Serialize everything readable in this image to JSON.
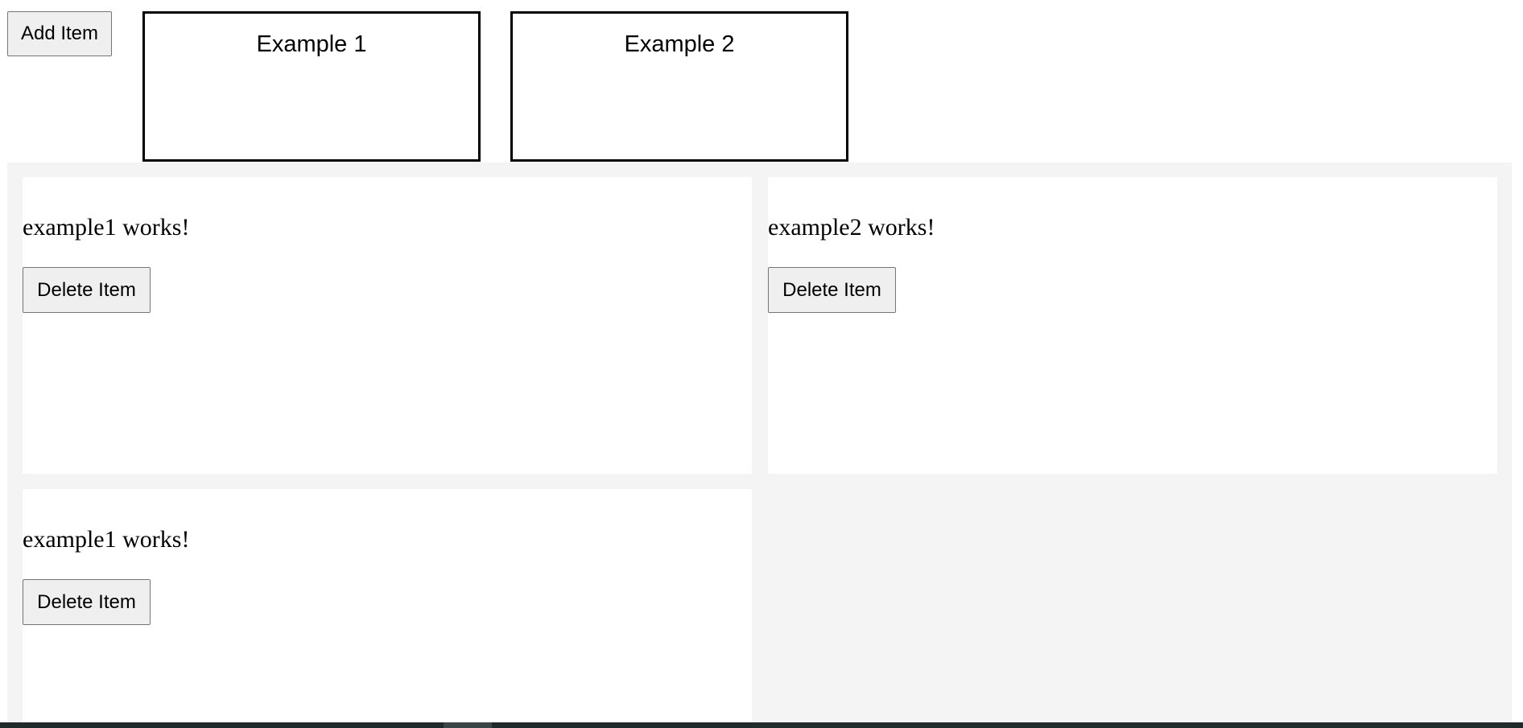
{
  "toolbar": {
    "add_label": "Add Item"
  },
  "palette": {
    "items": [
      {
        "label": "Example 1"
      },
      {
        "label": "Example 2"
      }
    ]
  },
  "grid": {
    "cards": [
      {
        "text": "example1 works!",
        "button": "Delete Item"
      },
      {
        "text": "example2 works!",
        "button": "Delete Item"
      },
      {
        "text": "example1 works!",
        "button": "Delete Item"
      }
    ]
  },
  "colors": {
    "grid_background": "#f4f4f4",
    "card_background": "#ffffff",
    "button_background": "#efefef",
    "taskbar": "#1f2a2a"
  }
}
